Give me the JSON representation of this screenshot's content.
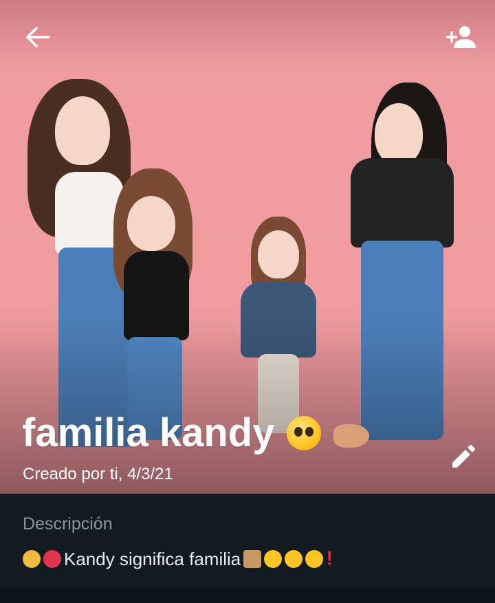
{
  "header": {
    "back_icon": "arrow-left-icon",
    "add_participant_icon": "person-add-icon"
  },
  "group": {
    "name": "familia kandy",
    "name_emojis": [
      "pleading-face-emoji",
      "pointing-hand-emoji"
    ],
    "created_text": "Creado por ti, 4/3/21",
    "edit_icon": "pencil-icon"
  },
  "description": {
    "label": "Descripción",
    "text": "Kandy significa familia",
    "leading_emojis": [
      "family-emoji",
      "mending-heart-emoji"
    ],
    "trailing_emojis": [
      "house-emoji",
      "pleading-face-emoji",
      "smiling-face-with-hearts-emoji",
      "face-blowing-kiss-emoji",
      "red-exclamation-emoji"
    ]
  },
  "colors": {
    "hero_background": "#f19da0",
    "panel_background": "#111b21",
    "label_color": "#8696a0",
    "text_color": "#e9edef"
  }
}
